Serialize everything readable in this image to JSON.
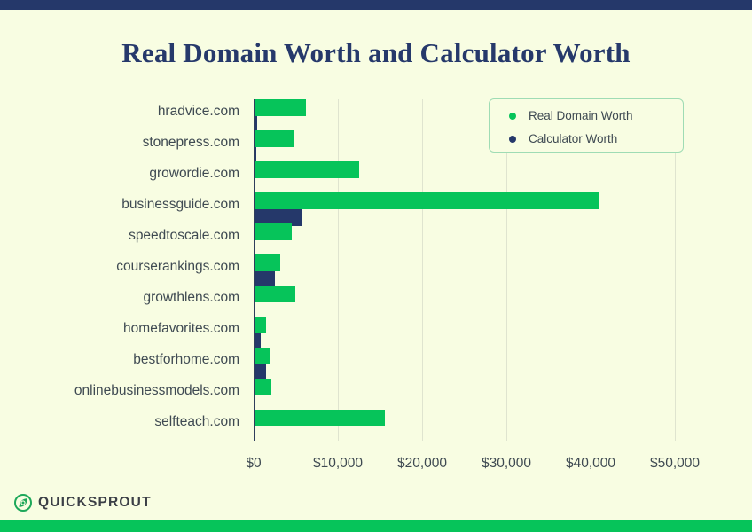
{
  "theme": {
    "background": "#f8fde2",
    "top_bar_color": "#25386a",
    "bottom_bar_color": "#06c45a",
    "title_color": "#26396b",
    "series_real_color": "#06c45a",
    "series_calc_color": "#25386a",
    "gridline_color": "#dfe4cf",
    "text_color": "#3f4a52"
  },
  "brand": {
    "logo_text": "QUICKSPROUT",
    "logo_icon": "quicksprout-leaf-icon"
  },
  "legend": {
    "items": [
      {
        "label": "Real Domain Worth",
        "color": "#06c45a"
      },
      {
        "label": "Calculator Worth",
        "color": "#25386a"
      }
    ]
  },
  "chart_data": {
    "type": "bar",
    "orientation": "horizontal",
    "title": "Real Domain Worth and Calculator Worth",
    "xlabel": "",
    "ylabel": "",
    "xlim": [
      0,
      53000
    ],
    "xticks": [
      0,
      10000,
      20000,
      30000,
      40000,
      50000
    ],
    "xtick_labels": [
      "$0",
      "$10,000",
      "$20,000",
      "$30,000",
      "$40,000",
      "$50,000"
    ],
    "grid": true,
    "legend_position": "top-right",
    "categories": [
      "hradvice.com",
      "stonepress.com",
      "growordie.com",
      "businessguide.com",
      "speedtoscale.com",
      "courserankings.com",
      "growthlens.com",
      "homefavorites.com",
      "bestforhome.com",
      "onlinebusinessmodels.com",
      "selfteach.com"
    ],
    "series": [
      {
        "name": "Real Domain Worth",
        "color": "#06c45a",
        "values": [
          6100,
          4700,
          12400,
          40800,
          4400,
          3100,
          4800,
          1400,
          1750,
          2000,
          15500
        ]
      },
      {
        "name": "Calculator Worth",
        "color": "#25386a",
        "values": [
          320,
          260,
          0,
          5700,
          0,
          2400,
          0,
          700,
          1400,
          0,
          0
        ]
      }
    ]
  }
}
